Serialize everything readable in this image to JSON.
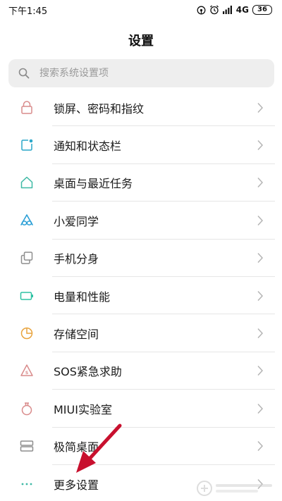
{
  "status_bar": {
    "time": "下午1:45",
    "network": "4G",
    "battery": "36"
  },
  "header": {
    "title": "设置"
  },
  "search": {
    "placeholder": "搜索系统设置项"
  },
  "settings_items": [
    {
      "label": "锁屏、密码和指纹",
      "icon": "lock-icon",
      "color": "#d98b8b"
    },
    {
      "label": "通知和状态栏",
      "icon": "notification-icon",
      "color": "#2aa7c9"
    },
    {
      "label": "桌面与最近任务",
      "icon": "home-icon",
      "color": "#3fb9a5"
    },
    {
      "label": "小爱同学",
      "icon": "xiaoai-icon",
      "color": "#2b9fd6"
    },
    {
      "label": "手机分身",
      "icon": "second-space-icon",
      "color": "#8e8e8e"
    },
    {
      "label": "电量和性能",
      "icon": "battery-icon",
      "color": "#2ec2a3"
    },
    {
      "label": "存储空间",
      "icon": "storage-icon",
      "color": "#e8a33d"
    },
    {
      "label": "SOS紧急求助",
      "icon": "sos-icon",
      "color": "#d98b8b"
    },
    {
      "label": "MIUI实验室",
      "icon": "lab-icon",
      "color": "#d98b8b"
    },
    {
      "label": "极简桌面",
      "icon": "simple-home-icon",
      "color": "#8e8e8e"
    },
    {
      "label": "更多设置",
      "icon": "more-dots-icon",
      "color": "#3fb9a5"
    }
  ],
  "colors": {
    "annotation_arrow": "#c8102e",
    "divider": "#e6e6e6",
    "chevron": "#b5b5b5"
  }
}
